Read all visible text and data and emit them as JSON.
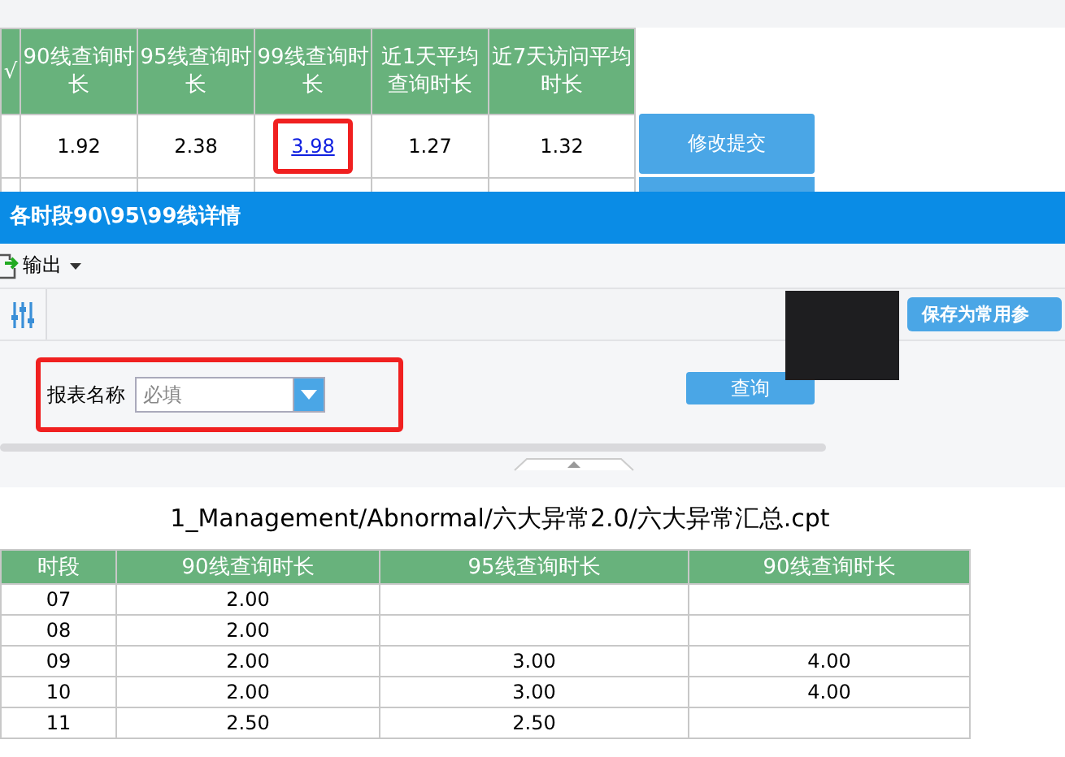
{
  "top_table": {
    "partial_column_header": "√",
    "columns": [
      "90线查询时长",
      "95线查询时长",
      "99线查询时长",
      "近1天平均查询时长",
      "近7天访问平均时长"
    ],
    "row": [
      {
        "text": "1.92",
        "link": false,
        "highlighted": false
      },
      {
        "text": "2.38",
        "link": false,
        "highlighted": false
      },
      {
        "text": "3.98",
        "link": true,
        "highlighted": true
      },
      {
        "text": "1.27",
        "link": false,
        "highlighted": false
      },
      {
        "text": "1.32",
        "link": false,
        "highlighted": false
      }
    ],
    "action_button": "修改提交"
  },
  "dialog": {
    "title": "各时段90\\95\\99线详情",
    "export_menu": "输出",
    "save_params_button": "保存为常用参",
    "param": {
      "label": "报表名称",
      "placeholder": "必填",
      "highlighted": true
    },
    "query_button": "查询"
  },
  "report": {
    "path": "1_Management/Abnormal/六大异常2.0/六大异常汇总.cpt",
    "columns": [
      "时段",
      "90线查询时长",
      "95线查询时长",
      "90线查询时长"
    ],
    "rows": [
      [
        "07",
        "2.00",
        "",
        ""
      ],
      [
        "08",
        "2.00",
        "",
        ""
      ],
      [
        "09",
        "2.00",
        "3.00",
        "4.00"
      ],
      [
        "10",
        "2.00",
        "3.00",
        "4.00"
      ],
      [
        "11",
        "2.50",
        "2.50",
        ""
      ]
    ]
  }
}
